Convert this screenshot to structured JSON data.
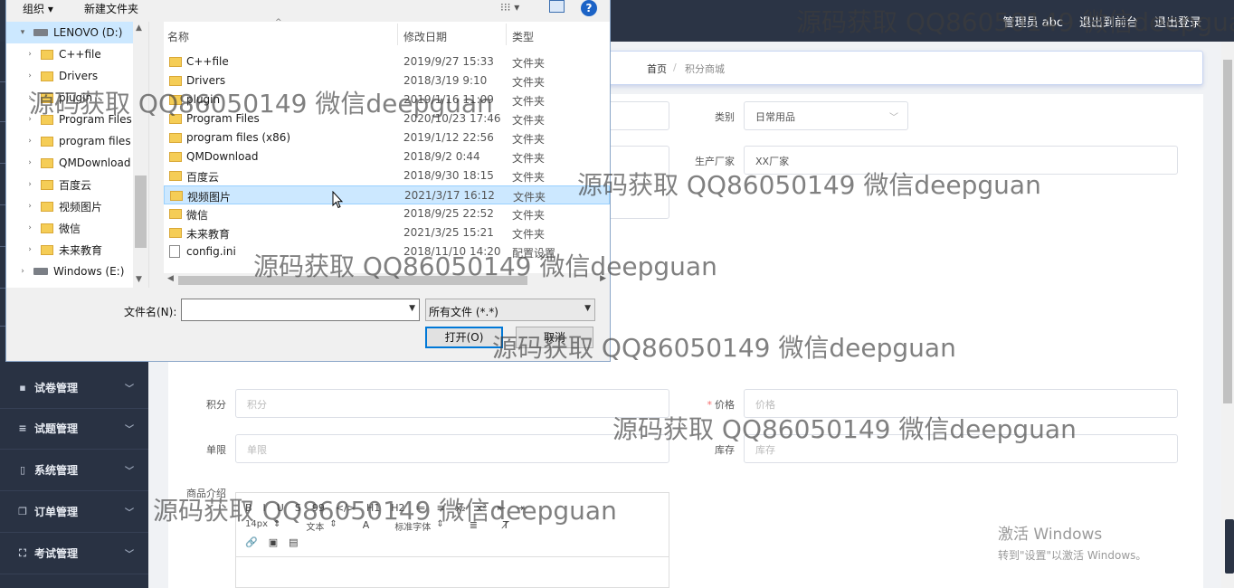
{
  "topbar": {
    "actions": [
      "管理员 abc",
      "退出到前台",
      "退出登录"
    ]
  },
  "sidebar": {
    "items": [
      {
        "label": "试卷管理",
        "icon": "briefcase-icon",
        "glyph": "▪"
      },
      {
        "label": "试题管理",
        "icon": "list-icon",
        "glyph": "≡"
      },
      {
        "label": "系统管理",
        "icon": "phone-icon",
        "glyph": "▯"
      },
      {
        "label": "订单管理",
        "icon": "copy-icon",
        "glyph": "❐"
      },
      {
        "label": "考试管理",
        "icon": "expand-icon",
        "glyph": "⛶"
      }
    ]
  },
  "breadcrumb": {
    "home": "首页",
    "separator": "/",
    "current": "积分商城"
  },
  "form": {
    "category_label": "类别",
    "category_value": "日常用品",
    "manufacturer_label": "生产厂家",
    "manufacturer_value": "XX厂家",
    "points_label": "积分",
    "points_placeholder": "积分",
    "price_label": "价格",
    "price_placeholder": "价格",
    "limit_label": "单限",
    "limit_placeholder": "单限",
    "stock_label": "库存",
    "stock_placeholder": "库存",
    "intro_label": "商品介绍",
    "editor_row1": [
      "B",
      "I",
      "U",
      "S",
      "99",
      "</>",
      "H1",
      "H2",
      "≔",
      "≡",
      "x₂",
      "x²",
      "⇤",
      "⇥"
    ],
    "editor_font_size": "14px",
    "editor_text": "文本",
    "editor_font": "标准字体",
    "editor_row3": [
      "🔗",
      "▣",
      "▤"
    ]
  },
  "activation": {
    "title": "激活 Windows",
    "subtitle": "转到\"设置\"以激活 Windows。"
  },
  "dialog": {
    "toolbar": {
      "organize": "组织 ▾",
      "new_folder": "新建文件夹",
      "help": "?",
      "view": "⁝⁝⁝ ▾"
    },
    "tree": [
      {
        "label": "LENOVO (D:)",
        "type": "drive",
        "twisty": "▾",
        "indent": 0,
        "selected": true
      },
      {
        "label": "C++file",
        "type": "folder",
        "twisty": "›",
        "indent": 1
      },
      {
        "label": "Drivers",
        "type": "folder",
        "twisty": "›",
        "indent": 1
      },
      {
        "label": "plugin",
        "type": "folder",
        "twisty": "›",
        "indent": 1
      },
      {
        "label": "Program Files",
        "type": "folder",
        "twisty": "›",
        "indent": 1
      },
      {
        "label": "program files",
        "type": "folder",
        "twisty": "›",
        "indent": 1
      },
      {
        "label": "QMDownload",
        "type": "folder",
        "twisty": "›",
        "indent": 1
      },
      {
        "label": "百度云",
        "type": "folder",
        "twisty": "›",
        "indent": 1
      },
      {
        "label": "视频图片",
        "type": "folder",
        "twisty": "›",
        "indent": 1
      },
      {
        "label": "微信",
        "type": "folder",
        "twisty": "›",
        "indent": 1
      },
      {
        "label": "未来教育",
        "type": "folder",
        "twisty": "›",
        "indent": 1
      },
      {
        "label": "Windows (E:)",
        "type": "drive",
        "twisty": "›",
        "indent": 0
      }
    ],
    "columns": {
      "name": "名称",
      "date": "修改日期",
      "type": "类型"
    },
    "files": [
      {
        "name": "C++file",
        "date": "2019/9/27 15:33",
        "type": "文件夹",
        "kind": "folder"
      },
      {
        "name": "Drivers",
        "date": "2018/3/19 9:10",
        "type": "文件夹",
        "kind": "folder"
      },
      {
        "name": "plugin",
        "date": "2019/1/16 11:09",
        "type": "文件夹",
        "kind": "folder"
      },
      {
        "name": "Program Files",
        "date": "2020/10/23 17:46",
        "type": "文件夹",
        "kind": "folder"
      },
      {
        "name": "program files (x86)",
        "date": "2019/1/12 22:56",
        "type": "文件夹",
        "kind": "folder"
      },
      {
        "name": "QMDownload",
        "date": "2018/9/2 0:44",
        "type": "文件夹",
        "kind": "folder"
      },
      {
        "name": "百度云",
        "date": "2018/9/30 18:15",
        "type": "文件夹",
        "kind": "folder"
      },
      {
        "name": "视频图片",
        "date": "2021/3/17 16:12",
        "type": "文件夹",
        "kind": "folder",
        "selected": true
      },
      {
        "name": "微信",
        "date": "2018/9/25 22:52",
        "type": "文件夹",
        "kind": "folder"
      },
      {
        "name": "未来教育",
        "date": "2021/3/25 15:21",
        "type": "文件夹",
        "kind": "folder"
      },
      {
        "name": "config.ini",
        "date": "2018/11/10 14:20",
        "type": "配置设置",
        "kind": "config"
      }
    ],
    "filename_label": "文件名(N):",
    "filename_value": "",
    "filetype_value": "所有文件 (*.*)",
    "open_label": "打开(O)",
    "cancel_label": "取消"
  },
  "watermarks": [
    "源码获取 QQ86050149 微信deepguan",
    "源码获取 QQ86050149 微信deepguan",
    "源码获取 QQ86050149 微信deepguan",
    "源码获取 QQ86050149 微信deepguan",
    "源码获取 QQ86050149 微信deepguan",
    "源码获取 QQ86050149 微信deepguan",
    "源码获取 QQ86050149 微信deepguan"
  ]
}
